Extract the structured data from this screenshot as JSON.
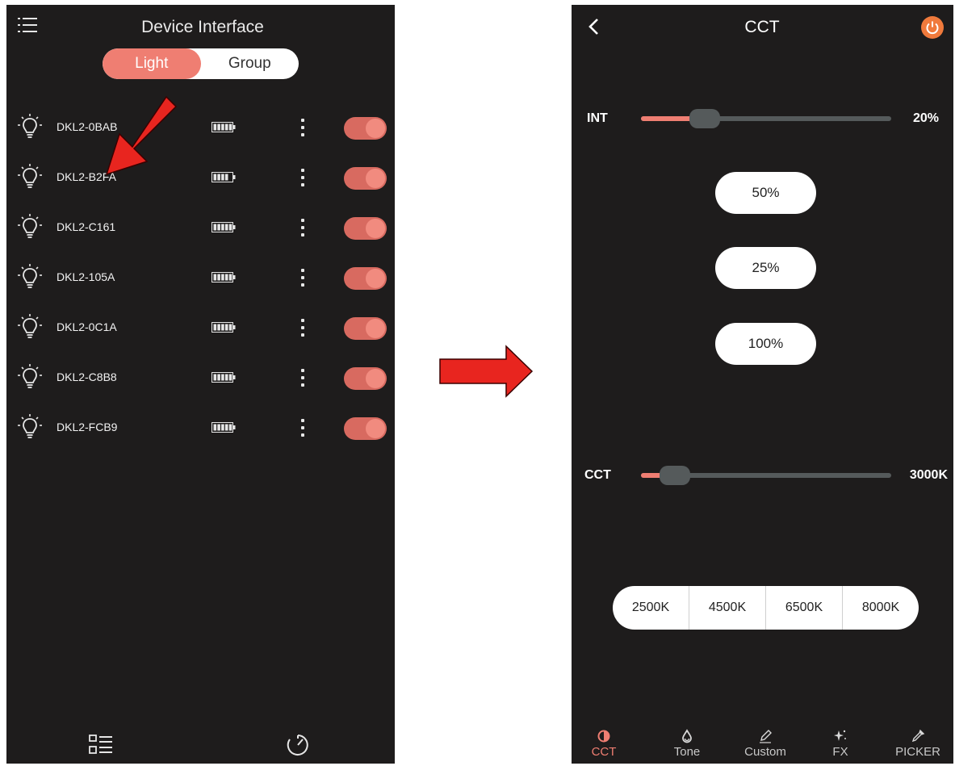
{
  "left_screen": {
    "title": "Device Interface",
    "segments": [
      {
        "label": "Light",
        "active": true
      },
      {
        "label": "Group",
        "active": false
      }
    ],
    "devices": [
      {
        "name": "DKL2-0BAB",
        "battery_level": 1.0,
        "on": true
      },
      {
        "name": "DKL2-B2FA",
        "battery_level": 0.7,
        "on": true
      },
      {
        "name": "DKL2-C161",
        "battery_level": 1.0,
        "on": true
      },
      {
        "name": "DKL2-105A",
        "battery_level": 1.0,
        "on": true
      },
      {
        "name": "DKL2-0C1A",
        "battery_level": 1.0,
        "on": true
      },
      {
        "name": "DKL2-C8B8",
        "battery_level": 1.0,
        "on": true
      },
      {
        "name": "DKL2-FCB9",
        "battery_level": 1.0,
        "on": true
      }
    ],
    "bottom_nav": [
      {
        "icon": "list-view-icon"
      },
      {
        "icon": "timer-icon"
      }
    ]
  },
  "right_screen": {
    "title": "CCT",
    "power_icon": "power-icon",
    "int_slider": {
      "label": "INT",
      "value": "20%",
      "fraction": 0.2
    },
    "presets": [
      "50%",
      "25%",
      "100%"
    ],
    "cct_slider": {
      "label": "CCT",
      "value": "3000K",
      "fraction": 0.08
    },
    "kelvin_presets": [
      "2500K",
      "4500K",
      "6500K",
      "8000K"
    ],
    "tabs": [
      {
        "label": "CCT",
        "icon": "half-circle-icon",
        "active": true
      },
      {
        "label": "Tone",
        "icon": "drop-icon",
        "active": false
      },
      {
        "label": "Custom",
        "icon": "pen-icon",
        "active": false
      },
      {
        "label": "FX",
        "icon": "sparkle-icon",
        "active": false
      },
      {
        "label": "PICKER",
        "icon": "eyedropper-icon",
        "active": false
      }
    ]
  },
  "colors": {
    "accent": "#ef7e72",
    "background": "#1e1c1c",
    "power": "#f07a3c",
    "arrow": "#e8251f"
  }
}
